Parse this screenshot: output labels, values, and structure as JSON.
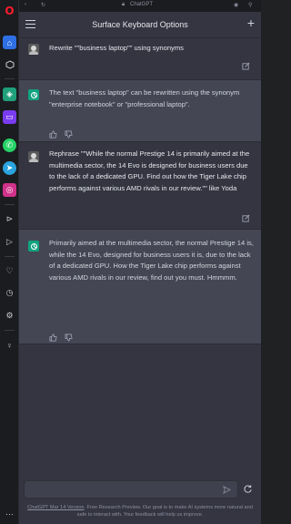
{
  "browser": {
    "tab_title": "ChatGPT"
  },
  "header": {
    "title": "Surface Keyboard Options",
    "new_chat": "+"
  },
  "messages": [
    {
      "role": "user",
      "text": "Rewrite \"\"business laptop\"\" using synonyms"
    },
    {
      "role": "assistant",
      "text": "The text \"business laptop\" can be rewritten using the synonym \"enterprise notebook\" or \"professional laptop\"."
    },
    {
      "role": "user",
      "text": "Rephrase \"\"While the normal Prestige 14 is primarily aimed at the multimedia sector, the 14 Evo is designed for business users due to the lack of a dedicated GPU. Find out how the Tiger Lake chip performs against various AMD rivals in our review.\"\" like Yoda"
    },
    {
      "role": "assistant",
      "text": "Primarily aimed at the multimedia sector, the normal Prestige 14 is, while the 14 Evo, designed for business users it is, due to the lack of a dedicated GPU. How the Tiger Lake chip performs against various AMD rivals in our review, find out you must. Hmmmm."
    }
  ],
  "composer": {
    "placeholder": ""
  },
  "footer": {
    "link": "ChatGPT Mar 14 Version",
    "text": ". Free Research Preview. Our goal is to make AI systems more natural and safe to interact with. Your feedback will help us improve."
  },
  "colors": {
    "background": "#343541",
    "assistant_row": "#444654",
    "accent": "#10a37f",
    "opera_red": "#ff1b2d"
  },
  "icons": {
    "opera_sidebar": [
      "opera-logo-icon",
      "home-icon",
      "box-icon",
      "green-app-icon",
      "twitch-icon",
      "whatsapp-icon",
      "telegram-icon",
      "instagram-icon",
      "play-icon",
      "send-icon",
      "heart-icon",
      "clock-icon",
      "gear-icon",
      "bulb-icon",
      "more-icon"
    ]
  }
}
